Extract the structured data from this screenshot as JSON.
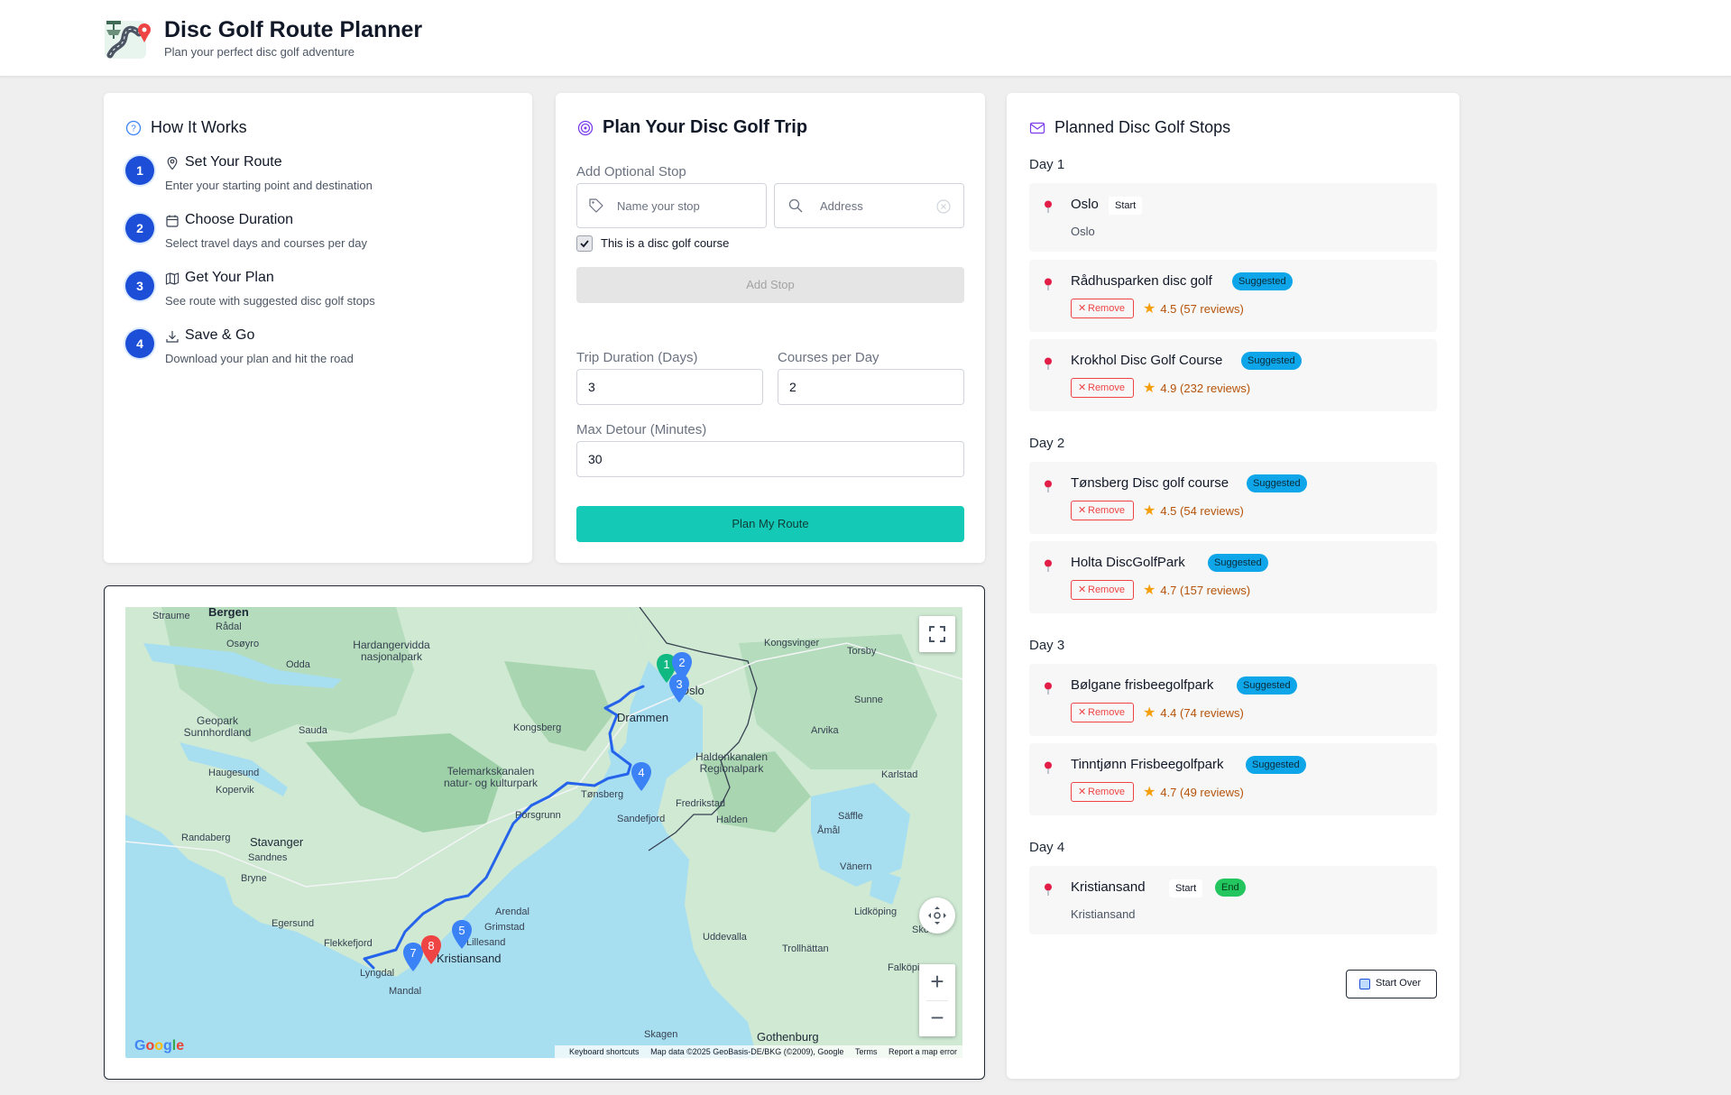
{
  "header": {
    "title": "Disc Golf Route Planner",
    "subtitle": "Plan your perfect disc golf adventure"
  },
  "how": {
    "title": "How It Works",
    "steps": [
      {
        "num": "1",
        "title": "Set Your Route",
        "desc": "Enter your starting point and destination",
        "icon": "map-pin-icon"
      },
      {
        "num": "2",
        "title": "Choose Duration",
        "desc": "Select travel days and courses per day",
        "icon": "calendar-icon"
      },
      {
        "num": "3",
        "title": "Get Your Plan",
        "desc": "See route with suggested disc golf stops",
        "icon": "map-icon"
      },
      {
        "num": "4",
        "title": "Save & Go",
        "desc": "Download your plan and hit the road",
        "icon": "download-icon"
      }
    ]
  },
  "plan": {
    "title": "Plan Your Disc Golf Trip",
    "add_stop_label": "Add Optional Stop",
    "name_placeholder": "Name your stop",
    "address_placeholder": "Address",
    "checkbox_label": "This is a disc golf course",
    "checkbox_checked": true,
    "add_stop_button": "Add Stop",
    "duration_label": "Trip Duration (Days)",
    "duration_value": "3",
    "courses_label": "Courses per Day",
    "courses_value": "2",
    "detour_label": "Max Detour (Minutes)",
    "detour_value": "30",
    "submit_button": "Plan My Route"
  },
  "stops": {
    "title": "Planned Disc Golf Stops",
    "days": [
      {
        "label": "Day 1"
      },
      {
        "label": "Day 2"
      },
      {
        "label": "Day 3"
      },
      {
        "label": "Day 4"
      }
    ],
    "items": [
      {
        "name": "Oslo",
        "badge": "Start",
        "sub": "Oslo"
      },
      {
        "name": "Rådhusparken disc golf",
        "badge": "Suggested",
        "remove": "Remove",
        "rating": "4.5 (57 reviews)"
      },
      {
        "name": "Krokhol Disc Golf Course",
        "badge": "Suggested",
        "remove": "Remove",
        "rating": "4.9 (232 reviews)"
      },
      {
        "name": "Tønsberg Disc golf course",
        "badge": "Suggested",
        "remove": "Remove",
        "rating": "4.5 (54 reviews)"
      },
      {
        "name": "Holta DiscGolfPark",
        "badge": "Suggested",
        "remove": "Remove",
        "rating": "4.7 (157 reviews)"
      },
      {
        "name": "Bølgane frisbeegolfpark",
        "badge": "Suggested",
        "remove": "Remove",
        "rating": "4.4 (74 reviews)"
      },
      {
        "name": "Tinntjønn Frisbeegolfpark",
        "badge": "Suggested",
        "remove": "Remove",
        "rating": "4.7 (49 reviews)"
      },
      {
        "name": "Kristiansand",
        "badge": "Start",
        "badge2": "End",
        "sub": "Kristiansand"
      }
    ],
    "start_over": "Start Over"
  },
  "map": {
    "labels": [
      "Bergen",
      "Straume",
      "Rådal",
      "Osøyro",
      "Odda",
      "Hardangervidda nasjonalpark",
      "Geopark Sunnhordland",
      "Sauda",
      "Haugesund",
      "Kopervik",
      "Stavanger",
      "Randaberg",
      "Sandnes",
      "Bryne",
      "Egersund",
      "Flekkefjord",
      "Lyngdal",
      "Mandal",
      "Kristiansand",
      "Lillesand",
      "Grimstad",
      "Arendal",
      "Porsgrunn",
      "Tønsberg",
      "Sandefjord",
      "Telemarkskanalen natur- og kulturpark",
      "Kongsberg",
      "Drammen",
      "Oslo",
      "Kongsvinger",
      "Torsby",
      "Sunne",
      "Arvika",
      "Haldenkanalen Regionalpark",
      "Fredrikstad",
      "Halden",
      "Karlstad",
      "Säffle",
      "Åmål",
      "Vänern",
      "Lidköping",
      "Skövde",
      "Uddevalla",
      "Trollhättan",
      "Falköping",
      "Skagen",
      "Gothenburg"
    ],
    "markers": [
      "1",
      "2",
      "3",
      "4",
      "5",
      "7",
      "8"
    ],
    "footer_items": [
      "Keyboard shortcuts",
      "Map data ©2025 GeoBasis-DE/BKG (©2009), Google",
      "Terms",
      "Report a map error"
    ],
    "google": "Google",
    "zoom_in": "+",
    "zoom_out": "−"
  },
  "colors": {
    "accent": "#1d4ed8",
    "primary_button": "#14c9b5",
    "suggested_badge": "#0ea5e9",
    "end_badge": "#22c55e",
    "remove": "#ef4444"
  }
}
